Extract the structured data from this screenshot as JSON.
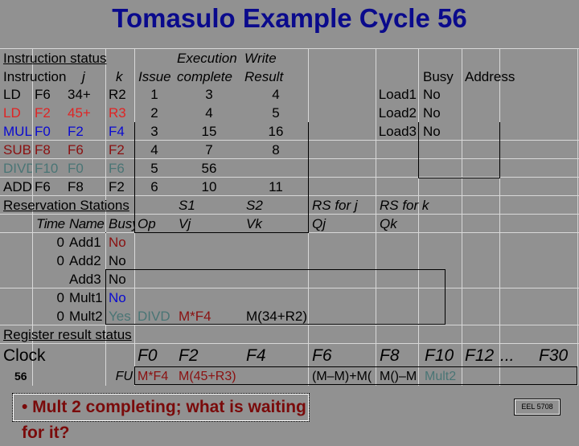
{
  "title": "Tomasulo Example Cycle 56",
  "instruction_status": {
    "section_label": "Instruction status",
    "headers": {
      "instruction": "Instruction",
      "j": "j",
      "k": "k",
      "issue": "Issue",
      "exec_top": "Execution",
      "exec_bottom": "complete",
      "write_top": "Write",
      "write_bottom": "Result"
    },
    "rows": [
      {
        "op": "LD",
        "dest": "F6",
        "j": "34+",
        "k": "R2",
        "issue": "1",
        "exec": "3",
        "write": "4",
        "color": "black"
      },
      {
        "op": "LD",
        "dest": "F2",
        "j": "45+",
        "k": "R3",
        "issue": "2",
        "exec": "4",
        "write": "5",
        "color": "red"
      },
      {
        "op": "MUL",
        "dest": "F0",
        "j": "F2",
        "k": "F4",
        "issue": "3",
        "exec": "15",
        "write": "16",
        "color": "blue"
      },
      {
        "op": "SUB",
        "dest": "F8",
        "j": "F6",
        "k": "F2",
        "issue": "4",
        "exec": "7",
        "write": "8",
        "color": "maroon"
      },
      {
        "op": "DIVD",
        "dest": "F10",
        "j": "F0",
        "k": "F6",
        "issue": "5",
        "exec": "56",
        "write": "",
        "color": "teal"
      },
      {
        "op": "ADD",
        "dest": "F6",
        "j": "F8",
        "k": "F2",
        "issue": "6",
        "exec": "10",
        "write": "11",
        "color": "black"
      }
    ]
  },
  "load_buffers": {
    "headers": {
      "busy": "Busy",
      "address": "Address"
    },
    "rows": [
      {
        "name": "Load1",
        "busy": "No",
        "address": ""
      },
      {
        "name": "Load2",
        "busy": "No",
        "address": ""
      },
      {
        "name": "Load3",
        "busy": "No",
        "address": ""
      }
    ]
  },
  "reservation_stations": {
    "section_label": "Reservation Stations",
    "headers_top": {
      "s1": "S1",
      "s2": "S2",
      "rsj": "RS for j",
      "rsk": "RS for k"
    },
    "headers": {
      "time": "Time",
      "name": "Name",
      "busy": "Busy",
      "op": "Op",
      "vj": "Vj",
      "vk": "Vk",
      "qj": "Qj",
      "qk": "Qk"
    },
    "rows": [
      {
        "time": "0",
        "name": "Add1",
        "busy": "No",
        "op": "",
        "vj": "",
        "vk": "",
        "qj": "",
        "qk": ""
      },
      {
        "time": "0",
        "name": "Add2",
        "busy": "No",
        "op": "",
        "vj": "",
        "vk": "",
        "qj": "",
        "qk": ""
      },
      {
        "time": "",
        "name": "Add3",
        "busy": "No",
        "op": "",
        "vj": "",
        "vk": "",
        "qj": "",
        "qk": ""
      },
      {
        "time": "0",
        "name": "Mult1",
        "busy": "No",
        "op": "",
        "vj": "",
        "vk": "",
        "qj": "",
        "qk": ""
      },
      {
        "time": "0",
        "name": "Mult2",
        "busy": "Yes",
        "op": "DIVD",
        "vj": "M*F4",
        "vk": "M(34+R2)",
        "qj": "",
        "qk": ""
      }
    ]
  },
  "register_status": {
    "section_label": "Register result status",
    "clock_label": "Clock",
    "clock_value": "56",
    "fu_label": "FU",
    "registers": [
      "F0",
      "F2",
      "F4",
      "F6",
      "F8",
      "F10",
      "F12",
      "...",
      "F30"
    ],
    "values": [
      "M*F4",
      "M(45+R3)",
      "",
      "(M–M)+M(",
      "M()–M",
      "Mult2",
      "",
      "",
      ""
    ]
  },
  "note": "• Mult 2 completing; what is waiting for it?",
  "badge": "EEL 5708",
  "colors": {
    "background": "#919191",
    "title": "#0a0a8c",
    "red": "#e02424",
    "blue": "#0a0ad0",
    "maroon": "#8a1010",
    "teal": "#4a7575",
    "note": "#7a0a0a"
  }
}
